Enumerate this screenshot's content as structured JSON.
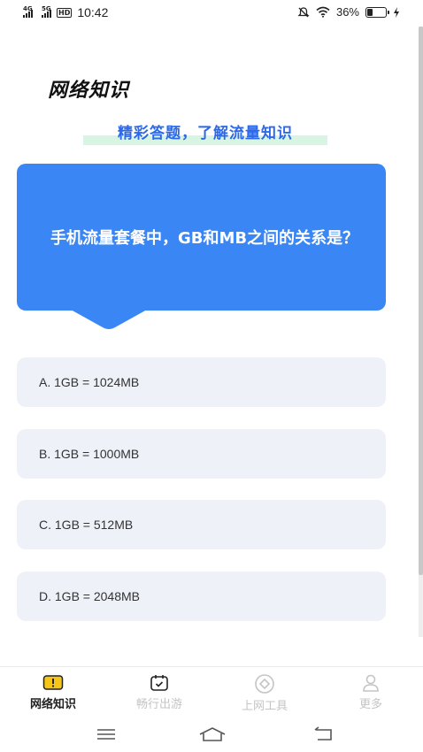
{
  "status_bar": {
    "signal1_label": "4G",
    "signal2_label": "5G",
    "hd_label": "HD",
    "time": "10:42",
    "battery_percent": "36%",
    "battery_level": 0.36,
    "icons": [
      "mute-icon",
      "wifi-icon",
      "battery-icon",
      "charging-icon"
    ]
  },
  "page": {
    "title": "网络知识",
    "subtitle": "精彩答题，了解流量知识"
  },
  "question": {
    "text": "手机流量套餐中，GB和MB之间的关系是？"
  },
  "options": [
    {
      "label": "A. 1GB = 1024MB"
    },
    {
      "label": "B. 1GB = 1000MB"
    },
    {
      "label": "C. 1GB = 512MB"
    },
    {
      "label": "D. 1GB = 2048MB"
    }
  ],
  "tabs": [
    {
      "label": "网络知识",
      "icon": "quiz-icon",
      "active": true
    },
    {
      "label": "畅行出游",
      "icon": "calendar-icon",
      "active": false
    },
    {
      "label": "上网工具",
      "icon": "tool-icon",
      "active": false
    },
    {
      "label": "更多",
      "icon": "profile-icon",
      "active": false
    }
  ],
  "nav": {
    "icons": [
      "menu-icon",
      "home-icon",
      "back-icon"
    ]
  },
  "colors": {
    "accent_blue": "#3a86f5",
    "subtitle_blue": "#2c68e8",
    "highlight_green": "#d8f5e3",
    "option_bg": "#eef1f7",
    "active_tab_icon": "#f5c518"
  }
}
